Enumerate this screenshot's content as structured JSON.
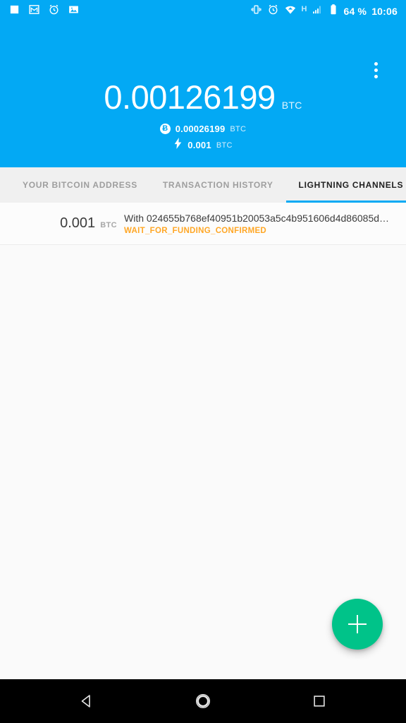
{
  "statusbar": {
    "left_icons": [
      "news-icon",
      "gmail-icon",
      "alarm-clock-icon",
      "photo-icon"
    ],
    "right_icons": [
      "vibrate-icon",
      "alarm-clock-icon",
      "wifi-icon",
      "signal-icon",
      "battery-icon"
    ],
    "network_type": "H",
    "battery_percent": "64 %",
    "clock": "10:06"
  },
  "header": {
    "overflow_menu": "more-options",
    "balance": {
      "amount": "0.00126199",
      "unit": "BTC"
    },
    "onchain": {
      "icon": "bitcoin-icon",
      "symbol": "Ƀ",
      "amount": "0.00026199",
      "unit": "BTC"
    },
    "lightning": {
      "icon": "lightning-bolt-icon",
      "amount": "0.001",
      "unit": "BTC"
    },
    "accent_color": "#03A9F4"
  },
  "tabs": [
    {
      "label": "YOUR BITCOIN ADDRESS",
      "active": false
    },
    {
      "label": "TRANSACTION HISTORY",
      "active": false
    },
    {
      "label": "LIGHTNING CHANNELS",
      "active": true
    }
  ],
  "channels": [
    {
      "amount": "0.001",
      "unit": "BTC",
      "peer": "With 024655b768ef40951b20053a5c4b951606d4d86085d…",
      "state": "WAIT_FOR_FUNDING_CONFIRMED",
      "state_color": "#FFA726"
    }
  ],
  "fab": {
    "label": "+",
    "name": "add-channel-button",
    "color": "#00C389"
  },
  "navbar": {
    "back": "back-button",
    "home": "home-button",
    "recents": "recents-button"
  }
}
